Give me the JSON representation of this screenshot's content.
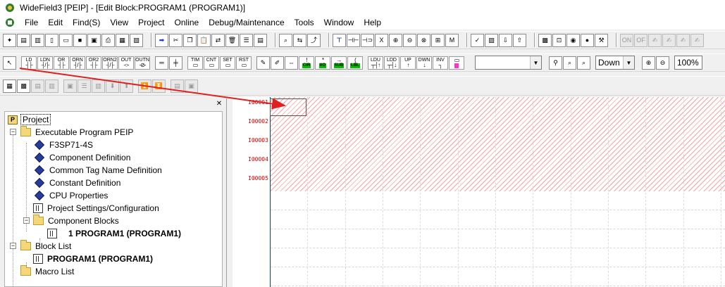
{
  "window": {
    "title": "WideField3 [PEIP] - [Edit Block:PROGRAM1 (PROGRAM1)]"
  },
  "menu": [
    "File",
    "Edit",
    "Find(S)",
    "View",
    "Project",
    "Online",
    "Debug/Maintenance",
    "Tools",
    "Window",
    "Help"
  ],
  "toolbar": {
    "instructions": [
      "LD",
      "LDN",
      "OR",
      "ORN",
      "OR2",
      "ORN2",
      "OUT",
      "OUTN"
    ],
    "timer_group": [
      "TIM",
      "CNT",
      "SET",
      "RST"
    ],
    "ladder_tags": [
      "CIR",
      "I/O",
      "SUB",
      "LBL"
    ],
    "ladder_upper": [
      "LDU",
      "LDD",
      "UP",
      "DWN",
      "INV"
    ],
    "ladder_upper_syms": [
      "┬┤↑",
      "┬┤↓",
      "↑",
      "↓",
      "┐"
    ],
    "find_combo": "",
    "direction": "Down",
    "zoom": "100%"
  },
  "tree": {
    "root": "Project",
    "executable": "Executable Program PEIP",
    "cpu_model": "F3SP71-4S",
    "component_definition": "Component Definition",
    "common_tag": "Common Tag Name Definition",
    "constant": "Constant Definition",
    "cpu_properties": "CPU Properties",
    "project_settings": "Project Settings/Configuration",
    "component_blocks": "Component Blocks",
    "block1": "1 PROGRAM1 (PROGRAM1)",
    "block_list": "Block List",
    "block_list_item": "PROGRAM1 (PROGRAM1)",
    "macro_list": "Macro List"
  },
  "ladder": {
    "rungs": [
      "I00001",
      "I00002",
      "I00003",
      "I00004",
      "I00005"
    ]
  },
  "colors": {
    "arrow": "#e02020",
    "hatch": "#f4a3a3",
    "rung_number": "#d00000"
  }
}
